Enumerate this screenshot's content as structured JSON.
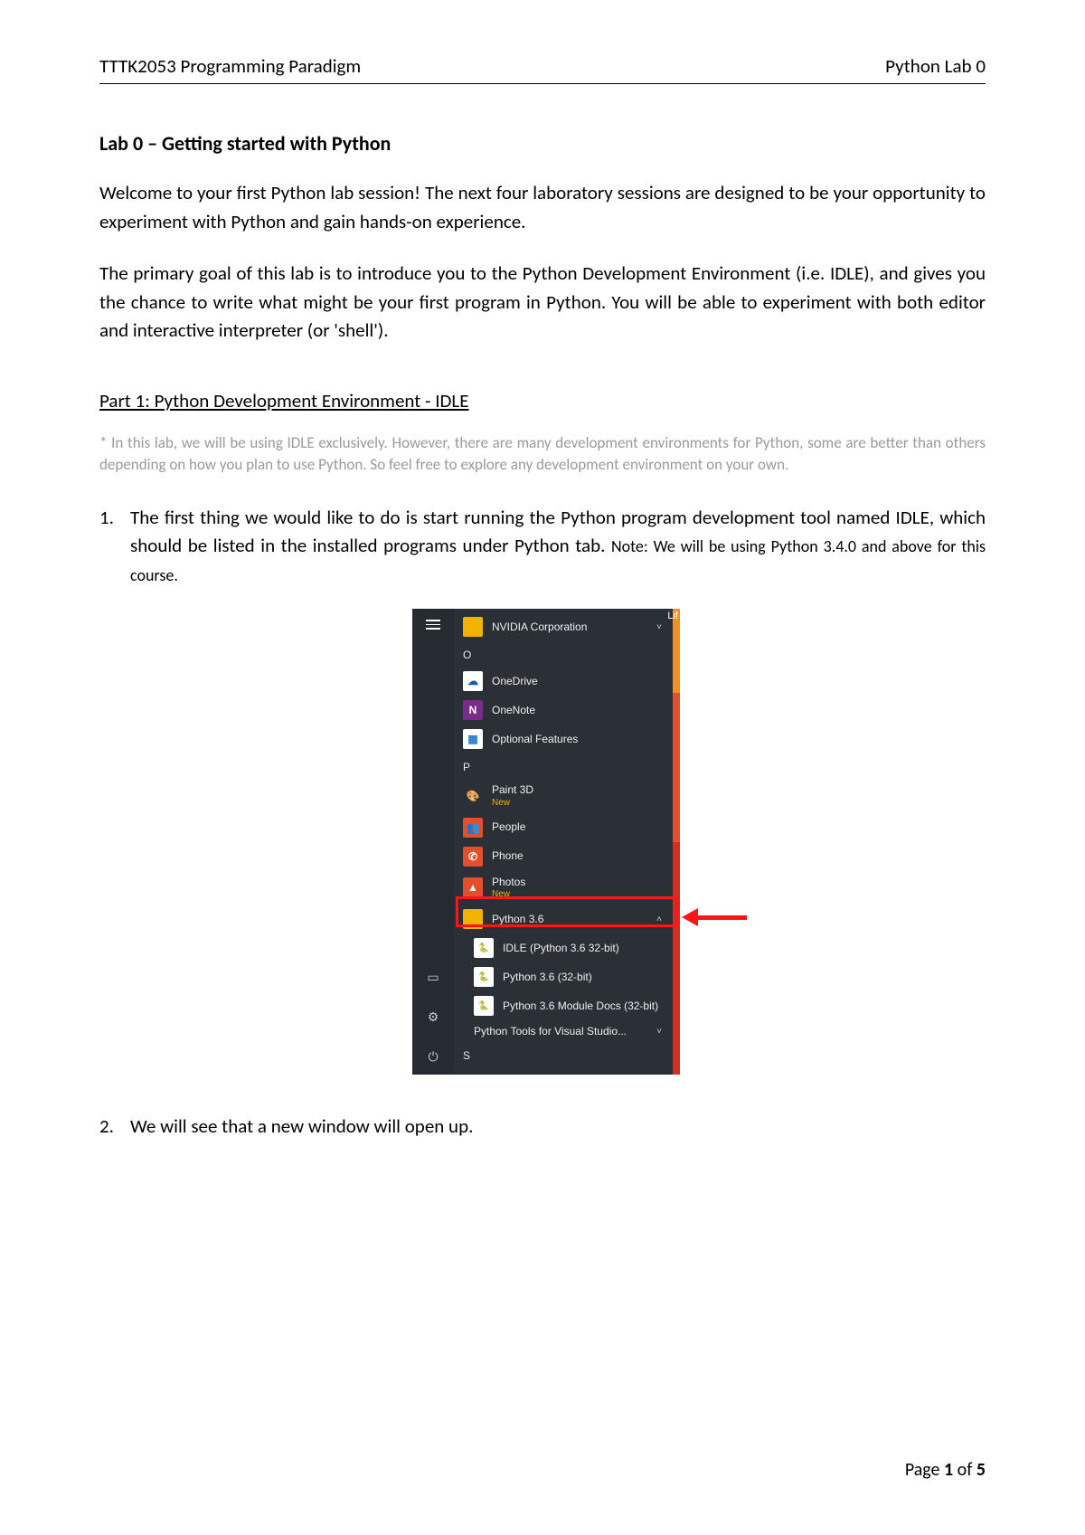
{
  "header": {
    "left": "TTTK2053 Programming Paradigm",
    "right": "Python Lab 0"
  },
  "title": "Lab 0 – Getting started with Python",
  "para1": "Welcome to your first Python lab session! The next four laboratory sessions are designed to be your opportunity to experiment with Python and gain hands-on experience.",
  "para2": "The primary goal of this lab is to introduce you to the Python Development Environment (i.e. IDLE), and gives you the chance to write what might be your first program in Python. You will be able to experiment with both editor and interactive interpreter (or 'shell').",
  "part_heading": "Part 1: Python Development Environment - IDLE",
  "note": "* In this lab, we will be using IDLE exclusively. However, there are many development environments for Python, some are better than others depending on how you plan to use Python. So feel free to explore any development environment on your own.",
  "item1": {
    "num": "1.",
    "body_main": "The first thing we would like to do is start running the Python program development tool named IDLE, which should be listed in the installed programs under Python tab. ",
    "body_note": "Note: We will be using Python 3.4.0 and above for this course."
  },
  "item2": {
    "num": "2.",
    "body": "We will see that a new window will open up."
  },
  "startmenu": {
    "top": "NVIDIA Corporation",
    "right_hint": "Lif",
    "letter_o": "O",
    "onedrive": "OneDrive",
    "onenote": "OneNote",
    "optional": "Optional Features",
    "letter_p": "P",
    "paint": "Paint 3D",
    "paint_sub": "New",
    "people": "People",
    "phone": "Phone",
    "photos": "Photos",
    "photos_sub": "New",
    "python36": "Python 3.6",
    "idle": "IDLE (Python 3.6 32-bit)",
    "py32": "Python 3.6 (32-bit)",
    "pydocs": "Python 3.6 Module Docs (32-bit)",
    "pytools": "Python Tools for Visual Studio...",
    "letter_s": "S"
  },
  "footer": {
    "prefix": "Page ",
    "cur": "1",
    "mid": " of ",
    "total": "5"
  }
}
